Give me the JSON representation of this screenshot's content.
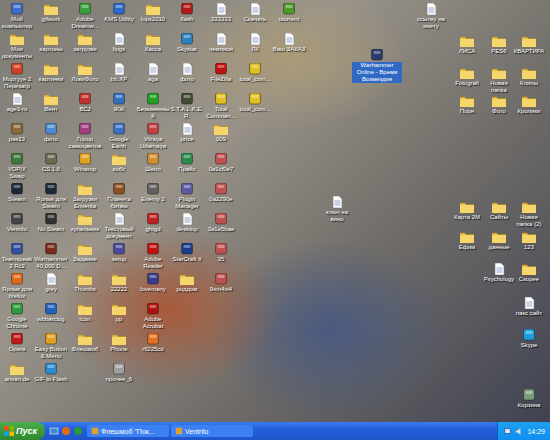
{
  "desktop": {
    "icon_columns": [
      {
        "icons": [
          {
            "label": "Мой компьютер",
            "kind": "app",
            "color": "#3b6fd0",
            "selected": false
          },
          {
            "label": "Мои документы",
            "kind": "folder",
            "selected": false
          },
          {
            "label": "Мортуун 2 Перезагр",
            "kind": "app",
            "color": "#d04020",
            "selected": false
          },
          {
            "label": "age3-ru",
            "kind": "doc",
            "selected": false
          },
          {
            "label": "pas13",
            "kind": "app",
            "color": "#8a6a3a",
            "selected": false
          },
          {
            "label": "VDPIX Swap",
            "kind": "app",
            "color": "#3a7a3a",
            "selected": false
          },
          {
            "label": "Steam",
            "kind": "app",
            "color": "#1b2838",
            "selected": false
          },
          {
            "label": "Ventrilo",
            "kind": "app",
            "color": "#444444",
            "selected": false
          },
          {
            "label": "Teamspeak 3 Rc2",
            "kind": "app",
            "color": "#3050a0",
            "selected": false
          },
          {
            "label": "Ярлык для firefox",
            "kind": "app",
            "color": "#e06a1a",
            "selected": false
          },
          {
            "label": "Google Chrome",
            "kind": "app",
            "color": "#2a9a3a",
            "selected": false
          },
          {
            "label": "Opera",
            "kind": "app",
            "color": "#c01818",
            "selected": false
          },
          {
            "label": "anvan.de",
            "kind": "folder",
            "selected": false
          }
        ]
      },
      {
        "icons": [
          {
            "label": "gifwork",
            "kind": "folder",
            "selected": false
          },
          {
            "label": "картоны",
            "kind": "folder",
            "selected": false
          },
          {
            "label": "картинки",
            "kind": "folder",
            "selected": false
          },
          {
            "label": "Вент",
            "kind": "folder",
            "selected": false
          },
          {
            "label": "фото",
            "kind": "app",
            "color": "#4a8ad0",
            "selected": false
          },
          {
            "label": "CS 1.6",
            "kind": "app",
            "color": "#6a6a50",
            "selected": false
          },
          {
            "label": "Ярлык для Steam",
            "kind": "app",
            "color": "#1b2838",
            "selected": false
          },
          {
            "label": "No Steam",
            "kind": "app",
            "color": "#303030",
            "selected": false
          },
          {
            "label": "Warhammer 40,000 D...",
            "kind": "app",
            "color": "#7a2a1a",
            "selected": false
          },
          {
            "label": "grey",
            "kind": "doc",
            "selected": false
          },
          {
            "label": "wbbarclog",
            "kind": "app",
            "color": "#2060c0",
            "selected": false
          },
          {
            "label": "Easy Button & Menu",
            "kind": "app",
            "color": "#e0a020",
            "selected": false
          },
          {
            "label": "GIF to Flash",
            "kind": "app",
            "color": "#2a8ad0",
            "selected": false
          }
        ]
      },
      {
        "icons": [
          {
            "label": "Adobe Dreamw...",
            "kind": "app",
            "color": "#3aa03a",
            "selected": false
          },
          {
            "label": "загрузки",
            "kind": "folder",
            "selected": false
          },
          {
            "label": "ЛокиФото",
            "kind": "folder",
            "selected": false
          },
          {
            "label": "ВСJ",
            "kind": "app",
            "color": "#c03030",
            "selected": false
          },
          {
            "label": "Город самоцветов",
            "kind": "app",
            "color": "#a04080",
            "selected": false
          },
          {
            "label": "Winamp",
            "kind": "app",
            "color": "#e0a020",
            "selected": false
          },
          {
            "label": "Загрузки Enventa",
            "kind": "folder",
            "selected": false
          },
          {
            "label": "купальник",
            "kind": "folder",
            "selected": false
          },
          {
            "label": "Задание",
            "kind": "folder",
            "selected": false
          },
          {
            "label": "Thumbs",
            "kind": "folder",
            "selected": false
          },
          {
            "label": "Icon",
            "kind": "folder",
            "selected": false
          },
          {
            "label": "Флешмоб",
            "kind": "folder",
            "selected": false
          }
        ]
      },
      {
        "icons": [
          {
            "label": "KMS Utility",
            "kind": "app",
            "color": "#2a6ad0",
            "selected": false
          },
          {
            "label": "lipgs",
            "kind": "doc",
            "selected": false
          },
          {
            "label": "bb.XP",
            "kind": "doc",
            "selected": false
          },
          {
            "label": "ЖЖ",
            "kind": "app",
            "color": "#3070c0",
            "selected": false
          },
          {
            "label": "Google Earth",
            "kind": "app",
            "color": "#3a70c0",
            "selected": false
          },
          {
            "label": "кобс",
            "kind": "folder",
            "selected": false
          },
          {
            "label": "Планета битвы",
            "kind": "app",
            "color": "#8a5020",
            "selected": false
          },
          {
            "label": "Текстовый документ",
            "kind": "doc",
            "selected": false
          },
          {
            "label": "setup",
            "kind": "app",
            "color": "#4a4a9a",
            "selected": false
          },
          {
            "label": "22222",
            "kind": "folder",
            "selected": false
          },
          {
            "label": "pp",
            "kind": "folder",
            "selected": false
          },
          {
            "label": "Phone",
            "kind": "folder",
            "selected": false
          },
          {
            "label": "прочее_6",
            "kind": "app",
            "color": "#a0a0a0",
            "selected": false
          }
        ]
      },
      {
        "icons": [
          {
            "label": "lops2010",
            "kind": "folder",
            "selected": false
          },
          {
            "label": "Касса",
            "kind": "folder",
            "selected": false
          },
          {
            "label": "aga",
            "kind": "doc",
            "selected": false
          },
          {
            "label": "Безымянный",
            "kind": "app",
            "color": "#20a020",
            "selected": false
          },
          {
            "label": "Vitraya Udarnaya",
            "kind": "app",
            "color": "#c04040",
            "selected": false
          },
          {
            "label": "Шелл",
            "kind": "app",
            "color": "#d09030",
            "selected": false
          },
          {
            "label": "Enemy 2",
            "kind": "app",
            "color": "#606060",
            "selected": false
          },
          {
            "label": "ghtgd",
            "kind": "app",
            "color": "#c02020",
            "selected": false
          },
          {
            "label": "Adobe Reader",
            "kind": "app",
            "color": "#c01010",
            "selected": false
          },
          {
            "label": "lovemany",
            "kind": "app",
            "color": "#3a3a8a",
            "selected": false
          },
          {
            "label": "Adobe Acrobat",
            "kind": "app",
            "color": "#b01010",
            "selected": false
          },
          {
            "label": "rfl225cd",
            "kind": "app",
            "color": "#e07020",
            "selected": false
          }
        ]
      },
      {
        "icons": [
          {
            "label": "flash",
            "kind": "app",
            "color": "#b01818",
            "selected": false
          },
          {
            "label": "Skystar",
            "kind": "app",
            "color": "#2a80c0",
            "selected": false
          },
          {
            "label": "фото",
            "kind": "doc",
            "selected": false
          },
          {
            "label": "S.T.A.L.K.E.R.",
            "kind": "app",
            "color": "#404a30",
            "selected": false
          },
          {
            "label": "price",
            "kind": "doc",
            "selected": false
          },
          {
            "label": "Прайс",
            "kind": "app",
            "color": "#2a8a4a",
            "selected": false
          },
          {
            "label": "Plugin Manager",
            "kind": "app",
            "color": "#5a5aa0",
            "selected": false
          },
          {
            "label": "desktop",
            "kind": "doc",
            "selected": false
          },
          {
            "label": "StarCraft II",
            "kind": "app",
            "color": "#1a3a8a",
            "selected": false
          },
          {
            "label": "роддом",
            "kind": "folder",
            "selected": false
          }
        ]
      },
      {
        "icons": [
          {
            "label": "333333",
            "kind": "doc",
            "selected": false
          },
          {
            "label": "чемпион",
            "kind": "doc",
            "selected": false
          },
          {
            "label": "FileZilla",
            "kind": "app",
            "color": "#c01010",
            "selected": false
          },
          {
            "label": "Total Comman...",
            "kind": "app",
            "color": "#e0c020",
            "selected": false
          },
          {
            "label": "009",
            "kind": "folder",
            "selected": false
          },
          {
            "label": "0a1cf0e7",
            "kind": "app",
            "color": "#c05050",
            "selected": false
          },
          {
            "label": "0a2290e",
            "kind": "app",
            "color": "#c05050",
            "selected": false
          },
          {
            "label": "3a1e5bae",
            "kind": "app",
            "color": "#c05050",
            "selected": false
          },
          {
            "label": "35",
            "kind": "app",
            "color": "#c05050",
            "selected": false
          },
          {
            "label": "9sm4xi4",
            "kind": "app",
            "color": "#c05050",
            "selected": false
          }
        ]
      },
      {
        "icons": [
          {
            "label": "Скачать",
            "kind": "doc",
            "selected": false
          },
          {
            "label": "ЛК",
            "kind": "doc",
            "selected": false
          },
          {
            "label": "total_com...",
            "kind": "app",
            "color": "#e0c020",
            "selected": false
          },
          {
            "label": "total_com...",
            "kind": "app",
            "color": "#e0c020",
            "selected": false
          }
        ]
      },
      {
        "icons": [
          {
            "label": "utorrent",
            "kind": "app",
            "color": "#4a9a2a",
            "selected": false
          },
          {
            "label": "Ваш ЗАКАЗ",
            "kind": "doc",
            "selected": false
          }
        ]
      }
    ],
    "free_icons": [
      {
        "label": "Warhammer Online - Время Возмездия",
        "kind": "app",
        "color": "#2a3a6a",
        "selected": true
      },
      {
        "label": "ключ на вино",
        "kind": "doc",
        "selected": false
      },
      {
        "label": "ссылку на инету",
        "kind": "doc",
        "selected": false
      },
      {
        "label": "ЛИСА",
        "kind": "folder",
        "selected": false
      },
      {
        "label": "PES6",
        "kind": "folder",
        "selected": false
      },
      {
        "label": "КВАРТИРА",
        "kind": "folder",
        "selected": false
      },
      {
        "label": "Fotografi",
        "kind": "folder",
        "selected": false
      },
      {
        "label": "Новая папка",
        "kind": "folder",
        "selected": false
      },
      {
        "label": "Клипы",
        "kind": "folder",
        "selected": false
      },
      {
        "label": "Порн",
        "kind": "folder",
        "selected": false
      },
      {
        "label": "Фото",
        "kind": "folder",
        "selected": false
      },
      {
        "label": "Кролики",
        "kind": "folder",
        "selected": false
      },
      {
        "label": "Карта 2М",
        "kind": "folder",
        "selected": false
      },
      {
        "label": "Сайты",
        "kind": "folder",
        "selected": false
      },
      {
        "label": "Новая папка (2)",
        "kind": "folder",
        "selected": false
      },
      {
        "label": "Ефим",
        "kind": "folder",
        "selected": false
      },
      {
        "label": "данные",
        "kind": "folder",
        "selected": false
      },
      {
        "label": "123",
        "kind": "folder",
        "selected": false
      },
      {
        "label": "Psychology",
        "kind": "doc",
        "selected": false
      },
      {
        "label": "Скорее",
        "kind": "folder",
        "selected": false
      },
      {
        "label": "пакс сайт",
        "kind": "doc",
        "selected": false
      },
      {
        "label": "Skype",
        "kind": "app",
        "color": "#1aa0e0",
        "selected": false
      },
      {
        "label": "Корзина",
        "kind": "app",
        "color": "#7a9a7a",
        "selected": false
      }
    ]
  },
  "taskbar": {
    "start": "Пуск",
    "tasks": [
      {
        "label": "Флешмоб \"Пок...",
        "selected": false
      },
      {
        "label": "Ventrilo",
        "selected": false
      }
    ],
    "clock": "14:29"
  }
}
